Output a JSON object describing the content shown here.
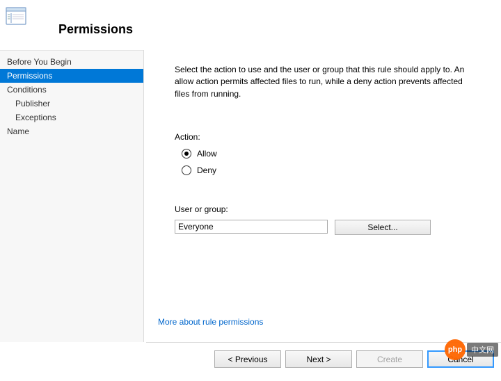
{
  "header": {
    "title": "Permissions"
  },
  "sidebar": {
    "items": [
      {
        "label": "Before You Begin",
        "indent": 0,
        "active": false
      },
      {
        "label": "Permissions",
        "indent": 0,
        "active": true
      },
      {
        "label": "Conditions",
        "indent": 0,
        "active": false
      },
      {
        "label": "Publisher",
        "indent": 1,
        "active": false
      },
      {
        "label": "Exceptions",
        "indent": 1,
        "active": false
      },
      {
        "label": "Name",
        "indent": 0,
        "active": false
      }
    ]
  },
  "main": {
    "instructions": "Select the action to use and the user or group that this rule should apply to. An allow action permits affected files to run, while a deny action prevents affected files from running.",
    "action_label": "Action:",
    "allow_label": "Allow",
    "deny_label": "Deny",
    "action_value": "allow",
    "user_group_label": "User or group:",
    "user_group_value": "Everyone",
    "select_button": "Select...",
    "more_link": "More about rule permissions"
  },
  "footer": {
    "previous": "< Previous",
    "next": "Next >",
    "create": "Create",
    "cancel": "Cancel"
  },
  "watermark": {
    "logo_text": "php",
    "text": "中文网"
  }
}
